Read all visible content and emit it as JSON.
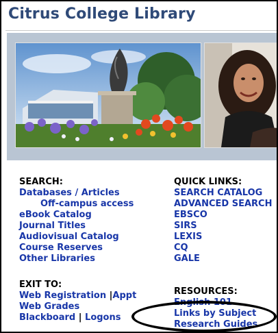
{
  "page": {
    "title": "Citrus College Library"
  },
  "search": {
    "heading": "SEARCH:",
    "links": [
      "Databases / Articles",
      "Off-campus access",
      "eBook Catalog",
      "Journal Titles",
      "Audiovisual Catalog",
      "Course Reserves",
      "Other Libraries"
    ]
  },
  "quick_links": {
    "heading": "QUICK LINKS:",
    "links": [
      "SEARCH CATALOG",
      "ADVANCED SEARCH",
      "EBSCO",
      "SIRS",
      "LEXIS",
      "CQ",
      "GALE"
    ]
  },
  "exit_to": {
    "heading": "EXIT TO:",
    "web_registration": "Web Registration",
    "appt": "Appt",
    "separator": "|",
    "web_grades": "Web Grades",
    "blackboard": "Blackboard",
    "logons": "Logons"
  },
  "resources": {
    "heading": "RESOURCES:",
    "links": [
      "English 101",
      "Links by Subject",
      "Research Guides"
    ]
  }
}
